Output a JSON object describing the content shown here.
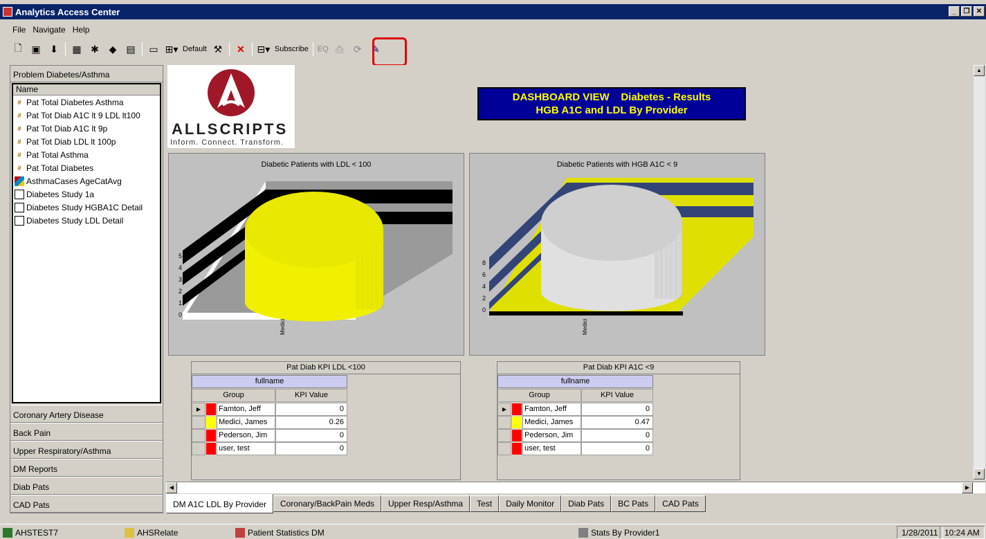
{
  "window": {
    "title": "Analytics Access Center"
  },
  "menu": [
    "File",
    "Navigate",
    "Help"
  ],
  "toolbar": {
    "default_label": "Default",
    "subscribe_label": "Subscribe",
    "eq_label": "EQ"
  },
  "left_panel": {
    "title": "Problem Diabetes/Asthma",
    "column_header": "Name",
    "items": [
      {
        "label": "Pat Total Diabetes Asthma",
        "icon": "kpi-icon"
      },
      {
        "label": "Pat Tot Diab A1C lt 9 LDL lt100",
        "icon": "kpi-icon"
      },
      {
        "label": "Pat Tot Diab A1C  lt 9p",
        "icon": "kpi-icon"
      },
      {
        "label": "Pat Tot Diab LDL lt 100p",
        "icon": "kpi-icon"
      },
      {
        "label": "Pat Total Asthma",
        "icon": "kpi-icon"
      },
      {
        "label": "Pat Total Diabetes",
        "icon": "kpi-icon"
      },
      {
        "label": "AsthmaCases AgeCatAvg",
        "icon": "cube-icon"
      },
      {
        "label": "Diabetes Study 1a",
        "icon": "report-icon"
      },
      {
        "label": "Diabetes Study HGBA1C Detail",
        "icon": "report-icon"
      },
      {
        "label": "Diabetes Study LDL Detail",
        "icon": "report-icon"
      }
    ],
    "categories": [
      "Coronary Artery Disease",
      "Back Pain",
      "Upper Respiratory/Asthma",
      "DM Reports",
      "Diab Pats",
      "CAD Pats"
    ]
  },
  "logo": {
    "name": "ALLSCRIPTS",
    "tagline": "Inform. Connect. Transform."
  },
  "dashboard_title": {
    "line1": "DASHBOARD VIEW    Diabetes - Results",
    "line2": "HGB A1C and LDL By Provider"
  },
  "chart_data": [
    {
      "type": "bar",
      "title": "Diabetic Patients with LDL < 100",
      "categories": [
        "Medici"
      ],
      "yticks": [
        "0",
        "1",
        "2",
        "3",
        "4",
        "5"
      ],
      "ylim": [
        0,
        5
      ],
      "colors": {
        "bar": "#ffff00",
        "floor": "#808080"
      }
    },
    {
      "type": "bar",
      "title": "Diabetic Patients with HGB A1C < 9",
      "categories": [
        "Medici"
      ],
      "yticks": [
        "0",
        "2",
        "4",
        "6",
        "8"
      ],
      "ylim": [
        0,
        8
      ],
      "colors": {
        "bar": "#e0e0e0",
        "floor": "#e0e000"
      }
    }
  ],
  "kpi_tables": [
    {
      "title": "Pat Diab KPI LDL <100",
      "field": "fullname",
      "col_group": "Group",
      "col_value": "KPI Value",
      "rows": [
        {
          "name": "Famton, Jeff",
          "value": "0",
          "color": "#ff0000"
        },
        {
          "name": "Medici, James",
          "value": "0.26",
          "color": "#ffff00"
        },
        {
          "name": "Pederson, Jim",
          "value": "0",
          "color": "#ff0000"
        },
        {
          "name": "user, test",
          "value": "0",
          "color": "#ff0000"
        }
      ]
    },
    {
      "title": "Pat Diab KPI A1C <9",
      "field": "fullname",
      "col_group": "Group",
      "col_value": "KPI Value",
      "rows": [
        {
          "name": "Famton, Jeff",
          "value": "0",
          "color": "#ff0000"
        },
        {
          "name": "Medici, James",
          "value": "0.47",
          "color": "#ffff00"
        },
        {
          "name": "Pederson, Jim",
          "value": "0",
          "color": "#ff0000"
        },
        {
          "name": "user, test",
          "value": "0",
          "color": "#ff0000"
        }
      ]
    }
  ],
  "tabs": [
    "DM A1C LDL By Provider",
    "Coronary/BackPain Meds",
    "Upper Resp/Asthma",
    "Test",
    "Daily Monitor",
    "Diab Pats",
    "BC Pats",
    "CAD Pats"
  ],
  "taskbar": {
    "items": [
      "AHSTEST7",
      "AHSRelate",
      "Patient Statistics DM",
      "Stats By Provider1"
    ],
    "date": "1/28/2011",
    "time": "10:24 AM"
  }
}
